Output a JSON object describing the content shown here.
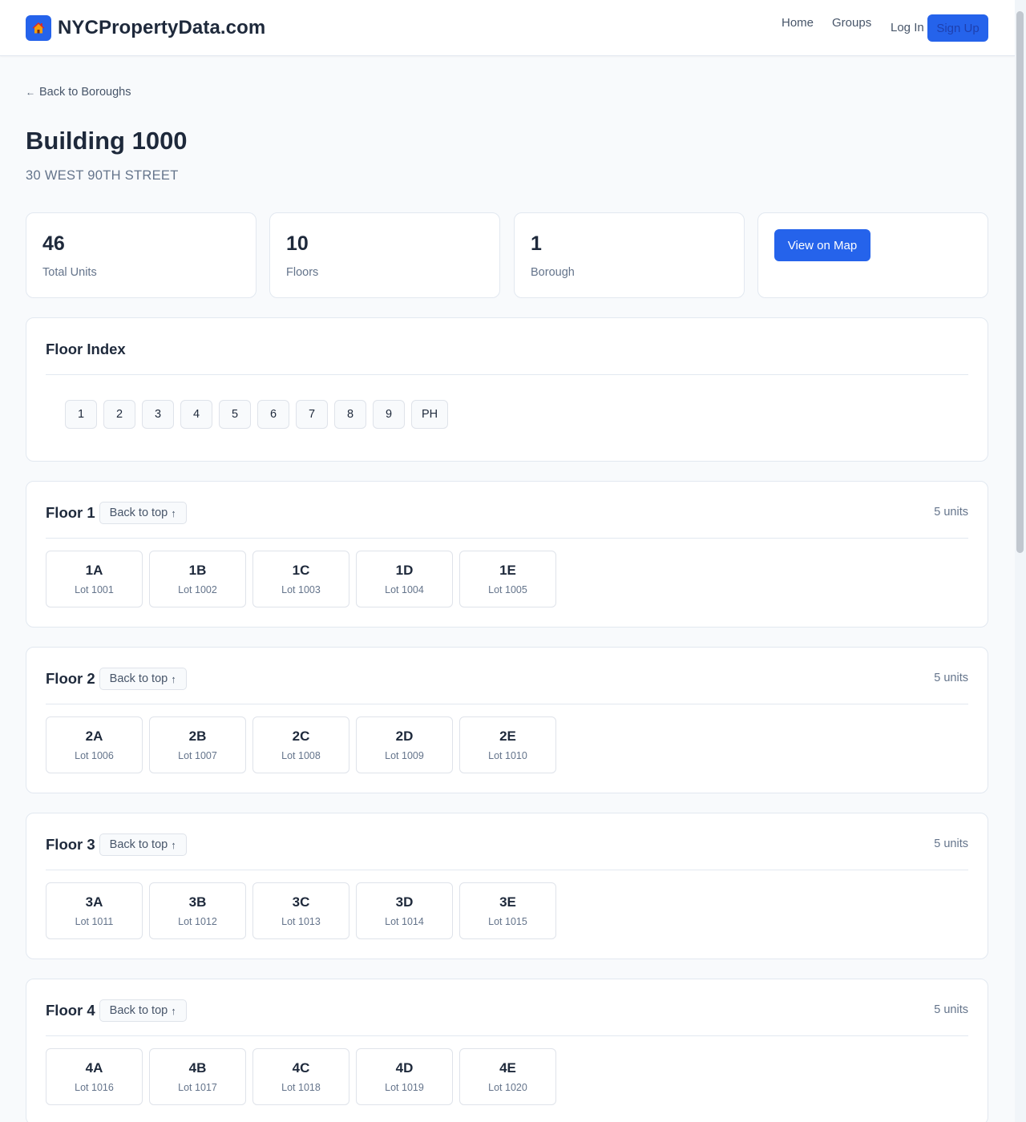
{
  "header": {
    "brand_icon": "house-icon",
    "brand_name": "NYCPropertyData.com",
    "nav": {
      "home": "Home",
      "groups": "Groups",
      "login": "Log In",
      "signup": "Sign Up"
    }
  },
  "back_link": "Back to Boroughs",
  "building": {
    "title": "Building 1000",
    "address": "30 WEST 90TH STREET"
  },
  "stats": [
    {
      "value": "46",
      "label": "Total Units"
    },
    {
      "value": "10",
      "label": "Floors"
    },
    {
      "value": "1",
      "label": "Borough"
    }
  ],
  "map_button": "View on Map",
  "floor_index": {
    "title": "Floor Index",
    "floors": [
      "1",
      "2",
      "3",
      "4",
      "5",
      "6",
      "7",
      "8",
      "9",
      "PH"
    ]
  },
  "back_to_top": "Back to top",
  "floors": [
    {
      "name": "Floor 1",
      "count": "5 units",
      "units": [
        {
          "id": "1A",
          "lot": "Lot 1001"
        },
        {
          "id": "1B",
          "lot": "Lot 1002"
        },
        {
          "id": "1C",
          "lot": "Lot 1003"
        },
        {
          "id": "1D",
          "lot": "Lot 1004"
        },
        {
          "id": "1E",
          "lot": "Lot 1005"
        }
      ]
    },
    {
      "name": "Floor 2",
      "count": "5 units",
      "units": [
        {
          "id": "2A",
          "lot": "Lot 1006"
        },
        {
          "id": "2B",
          "lot": "Lot 1007"
        },
        {
          "id": "2C",
          "lot": "Lot 1008"
        },
        {
          "id": "2D",
          "lot": "Lot 1009"
        },
        {
          "id": "2E",
          "lot": "Lot 1010"
        }
      ]
    },
    {
      "name": "Floor 3",
      "count": "5 units",
      "units": [
        {
          "id": "3A",
          "lot": "Lot 1011"
        },
        {
          "id": "3B",
          "lot": "Lot 1012"
        },
        {
          "id": "3C",
          "lot": "Lot 1013"
        },
        {
          "id": "3D",
          "lot": "Lot 1014"
        },
        {
          "id": "3E",
          "lot": "Lot 1015"
        }
      ]
    },
    {
      "name": "Floor 4",
      "count": "5 units",
      "units": [
        {
          "id": "4A",
          "lot": "Lot 1016"
        },
        {
          "id": "4B",
          "lot": "Lot 1017"
        },
        {
          "id": "4C",
          "lot": "Lot 1018"
        },
        {
          "id": "4D",
          "lot": "Lot 1019"
        },
        {
          "id": "4E",
          "lot": "Lot 1020"
        }
      ]
    }
  ]
}
